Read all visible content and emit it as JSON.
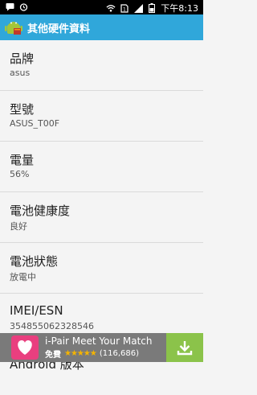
{
  "status_bar": {
    "time": "下午8:13",
    "icons": [
      "message-icon",
      "alarm-icon",
      "wifi-icon",
      "sim-icon",
      "signal-icon",
      "battery-icon"
    ]
  },
  "app_bar": {
    "title": "其他硬件資料",
    "logo": "android-logo-icon",
    "color": "#30a7da"
  },
  "items": [
    {
      "label": "品牌",
      "value": "asus"
    },
    {
      "label": "型號",
      "value": "ASUS_T00F"
    },
    {
      "label": "電量",
      "value": "56%"
    },
    {
      "label": "電池健康度",
      "value": "良好"
    },
    {
      "label": "電池狀態",
      "value": "放電中"
    },
    {
      "label": "IMEI/ESN",
      "value": "354855062328546"
    },
    {
      "label": "Android 版本",
      "value": ""
    }
  ],
  "ad": {
    "title": "i-Pair Meet Your Match",
    "free": "免費",
    "rating_count": "(116,686)",
    "rating": 4.5,
    "download_icon": "download-icon",
    "accent": "#8bc34a"
  }
}
